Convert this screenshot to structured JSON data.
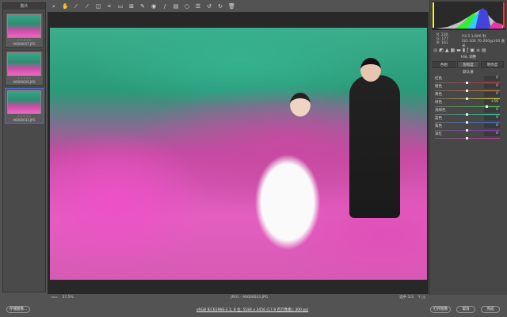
{
  "filmstrip": {
    "title": "胶片",
    "items": [
      {
        "name": "A6000017.JPG",
        "stars": "• • • • •"
      },
      {
        "name": "A6000026.JPG",
        "stars": "• • • • •"
      },
      {
        "name": "A6000033.JPG",
        "stars": "• • • • •",
        "selected": true
      }
    ]
  },
  "toolbar": {
    "icons": [
      "zoom-icon",
      "hand-icon",
      "white-balance-icon",
      "color-sampler-icon",
      "target-adjust-icon",
      "crop-icon",
      "straighten-icon",
      "transform-icon",
      "spot-removal-icon",
      "redeye-icon",
      "brush-icon",
      "graduated-filter-icon",
      "radial-filter-icon",
      "preferences-icon",
      "rotate-left-icon",
      "rotate-right-icon",
      "trash-icon"
    ]
  },
  "status": {
    "zoom": "37.5%",
    "filename": "JPEG - A6000033.JPG",
    "select": "选中 1/3"
  },
  "histogram": {
    "r": "R: 230",
    "g": "G: 177",
    "b": "B: 161",
    "aperture": "f/4.5  1/400 秒",
    "iso": "ISO 100  70-200@100 毫米"
  },
  "panel": {
    "title": "HSL 调整",
    "tabs": [
      "色相",
      "饱和度",
      "明亮度"
    ],
    "active_tab": 1,
    "default": "默认值",
    "sliders": [
      {
        "label": "红色",
        "value": "0",
        "pos": 0.5,
        "color": "#c33"
      },
      {
        "label": "橙色",
        "value": "0",
        "pos": 0.5,
        "color": "#c73"
      },
      {
        "label": "黄色",
        "value": "0",
        "pos": 0.5,
        "color": "#cc3"
      },
      {
        "label": "绿色",
        "value": "+56",
        "pos": 0.78,
        "color": "#4b4"
      },
      {
        "label": "浅绿色",
        "value": "0",
        "pos": 0.5,
        "color": "#3b9"
      },
      {
        "label": "蓝色",
        "value": "0",
        "pos": 0.5,
        "color": "#36c"
      },
      {
        "label": "紫色",
        "value": "0",
        "pos": 0.5,
        "color": "#83c"
      },
      {
        "label": "洋红",
        "value": "0",
        "pos": 0.5,
        "color": "#c3a"
      }
    ]
  },
  "footer": {
    "save": "存储图像...",
    "info": "sRGB IEC61966-2.1; 8 位; 5184 x 3456 (17.9 百万像素); 300 ppi",
    "open": "打开图像",
    "cancel": "取消",
    "done": "完成"
  }
}
